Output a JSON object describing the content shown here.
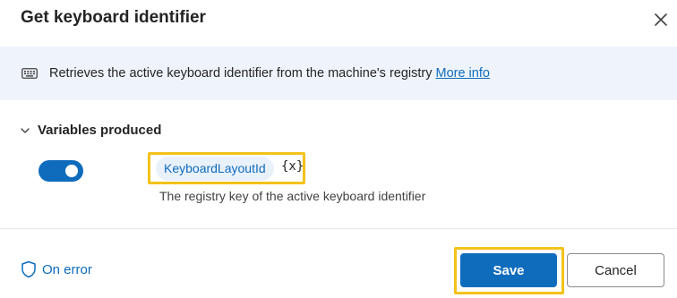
{
  "dialog": {
    "title": "Get keyboard identifier",
    "close_icon": "close-icon"
  },
  "info": {
    "icon": "keyboard-icon",
    "text": "Retrieves the active keyboard identifier from the machine's registry",
    "link": "More info"
  },
  "variables": {
    "section_label": "Variables produced",
    "toggle_on": true,
    "items": [
      {
        "name": "KeyboardLayoutId",
        "badge": "{x}",
        "description": "The registry key of the active keyboard identifier"
      }
    ]
  },
  "footer": {
    "on_error_label": "On error",
    "save_label": "Save",
    "cancel_label": "Cancel"
  },
  "colors": {
    "accent": "#0f6cbd",
    "banner_bg": "#eff4fc",
    "highlight": "#f3c21a"
  }
}
